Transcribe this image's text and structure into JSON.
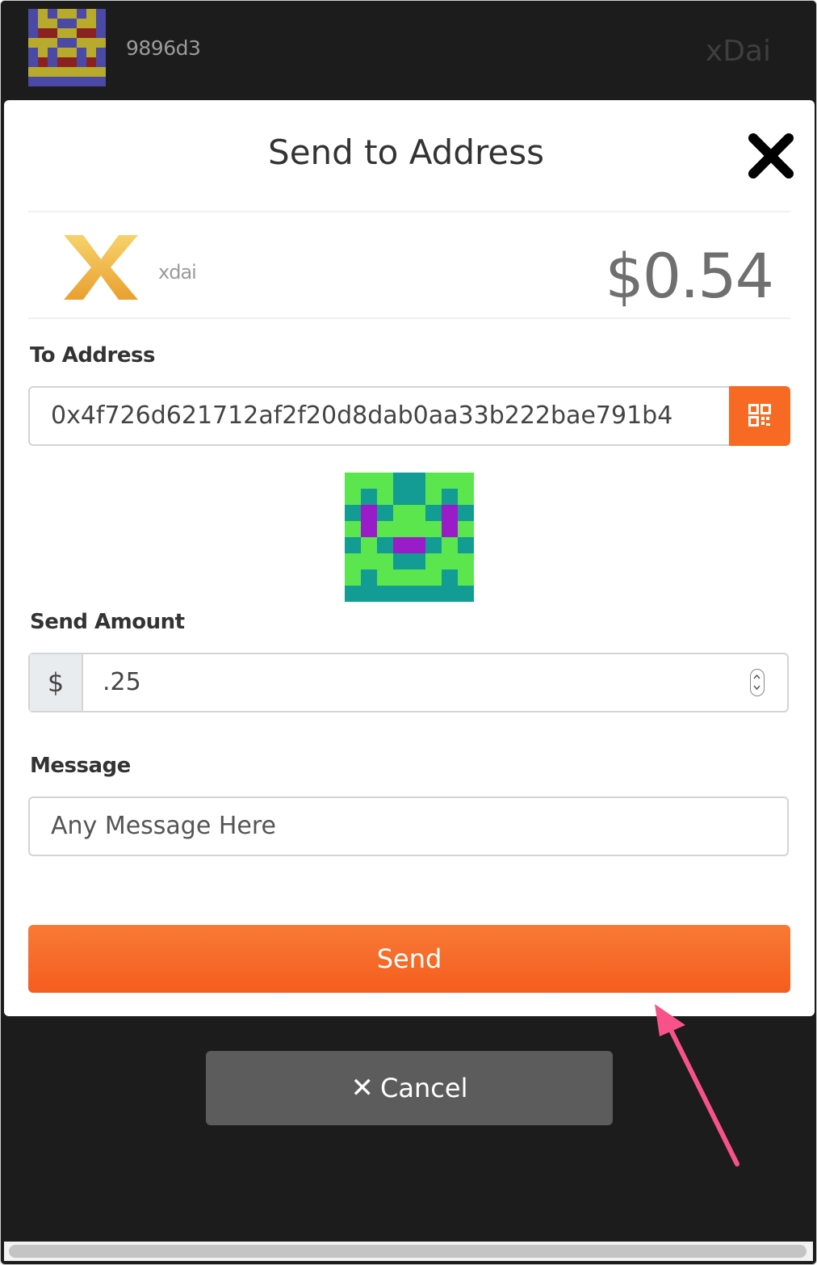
{
  "header": {
    "account_name": "9896d3",
    "network_name": "xDai"
  },
  "modal": {
    "title": "Send to Address",
    "token": {
      "symbol": "xdai",
      "balance": "$0.54",
      "logo_icon": "xdai-x-logo"
    }
  },
  "form": {
    "to_address": {
      "label": "To Address",
      "value": "0x4f726d621712af2f20d8dab0aa33b222bae791b4",
      "scan_icon": "qr-code-icon"
    },
    "send_amount": {
      "label": "Send Amount",
      "currency_symbol": "$",
      "value": ".25"
    },
    "message": {
      "label": "Message",
      "placeholder": "Any Message Here"
    },
    "send_label": "Send"
  },
  "footer": {
    "cancel_label": "Cancel",
    "cancel_icon": "✕"
  },
  "colors": {
    "accent": "#f76a24",
    "dark_bg": "#1c1c1c",
    "cancel_bg": "#5c5c5c",
    "annotation_arrow": "#f7538a"
  }
}
